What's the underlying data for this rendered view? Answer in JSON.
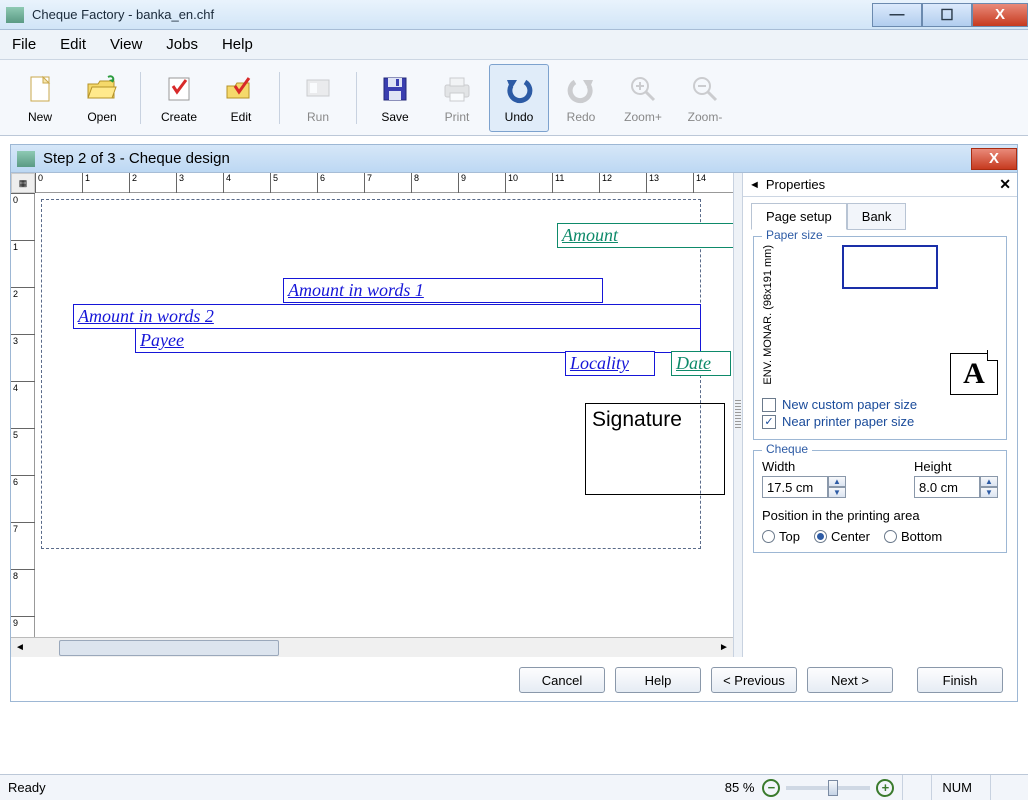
{
  "window": {
    "title": "Cheque Factory - banka_en.chf"
  },
  "menu": [
    "File",
    "Edit",
    "View",
    "Jobs",
    "Help"
  ],
  "toolbar": {
    "new": "New",
    "open": "Open",
    "create": "Create",
    "edit": "Edit",
    "run": "Run",
    "save": "Save",
    "print": "Print",
    "undo": "Undo",
    "redo": "Redo",
    "zoom_in": "Zoom+",
    "zoom_out": "Zoom-"
  },
  "inner": {
    "title": "Step 2 of 3 - Cheque design"
  },
  "ruler_h": [
    "0",
    "1",
    "2",
    "3",
    "4",
    "5",
    "6",
    "7",
    "8",
    "9",
    "10",
    "11",
    "12",
    "13",
    "14"
  ],
  "ruler_v": [
    "0",
    "1",
    "2",
    "3",
    "4",
    "5",
    "6",
    "7",
    "8",
    "9"
  ],
  "fields": {
    "amount": "Amount",
    "words1": "Amount in words 1",
    "words2": "Amount in words 2",
    "payee": "Payee",
    "locality": "Locality",
    "date": "Date",
    "signature": "Signature"
  },
  "props": {
    "title": "Properties",
    "tabs": {
      "page": "Page setup",
      "bank": "Bank"
    },
    "paper_size": {
      "legend": "Paper size",
      "name": "ENV. MONAR. (98x191 mm)",
      "custom": "New custom paper size",
      "near": "Near printer paper size"
    },
    "cheque": {
      "legend": "Cheque",
      "width_label": "Width",
      "width_value": "17.5 cm",
      "height_label": "Height",
      "height_value": "8.0 cm",
      "position_label": "Position in the printing area",
      "top": "Top",
      "center": "Center",
      "bottom": "Bottom"
    }
  },
  "wizard": {
    "cancel": "Cancel",
    "help": "Help",
    "prev": "< Previous",
    "next": "Next >",
    "finish": "Finish"
  },
  "status": {
    "ready": "Ready",
    "zoom": "85 %",
    "num": "NUM"
  }
}
